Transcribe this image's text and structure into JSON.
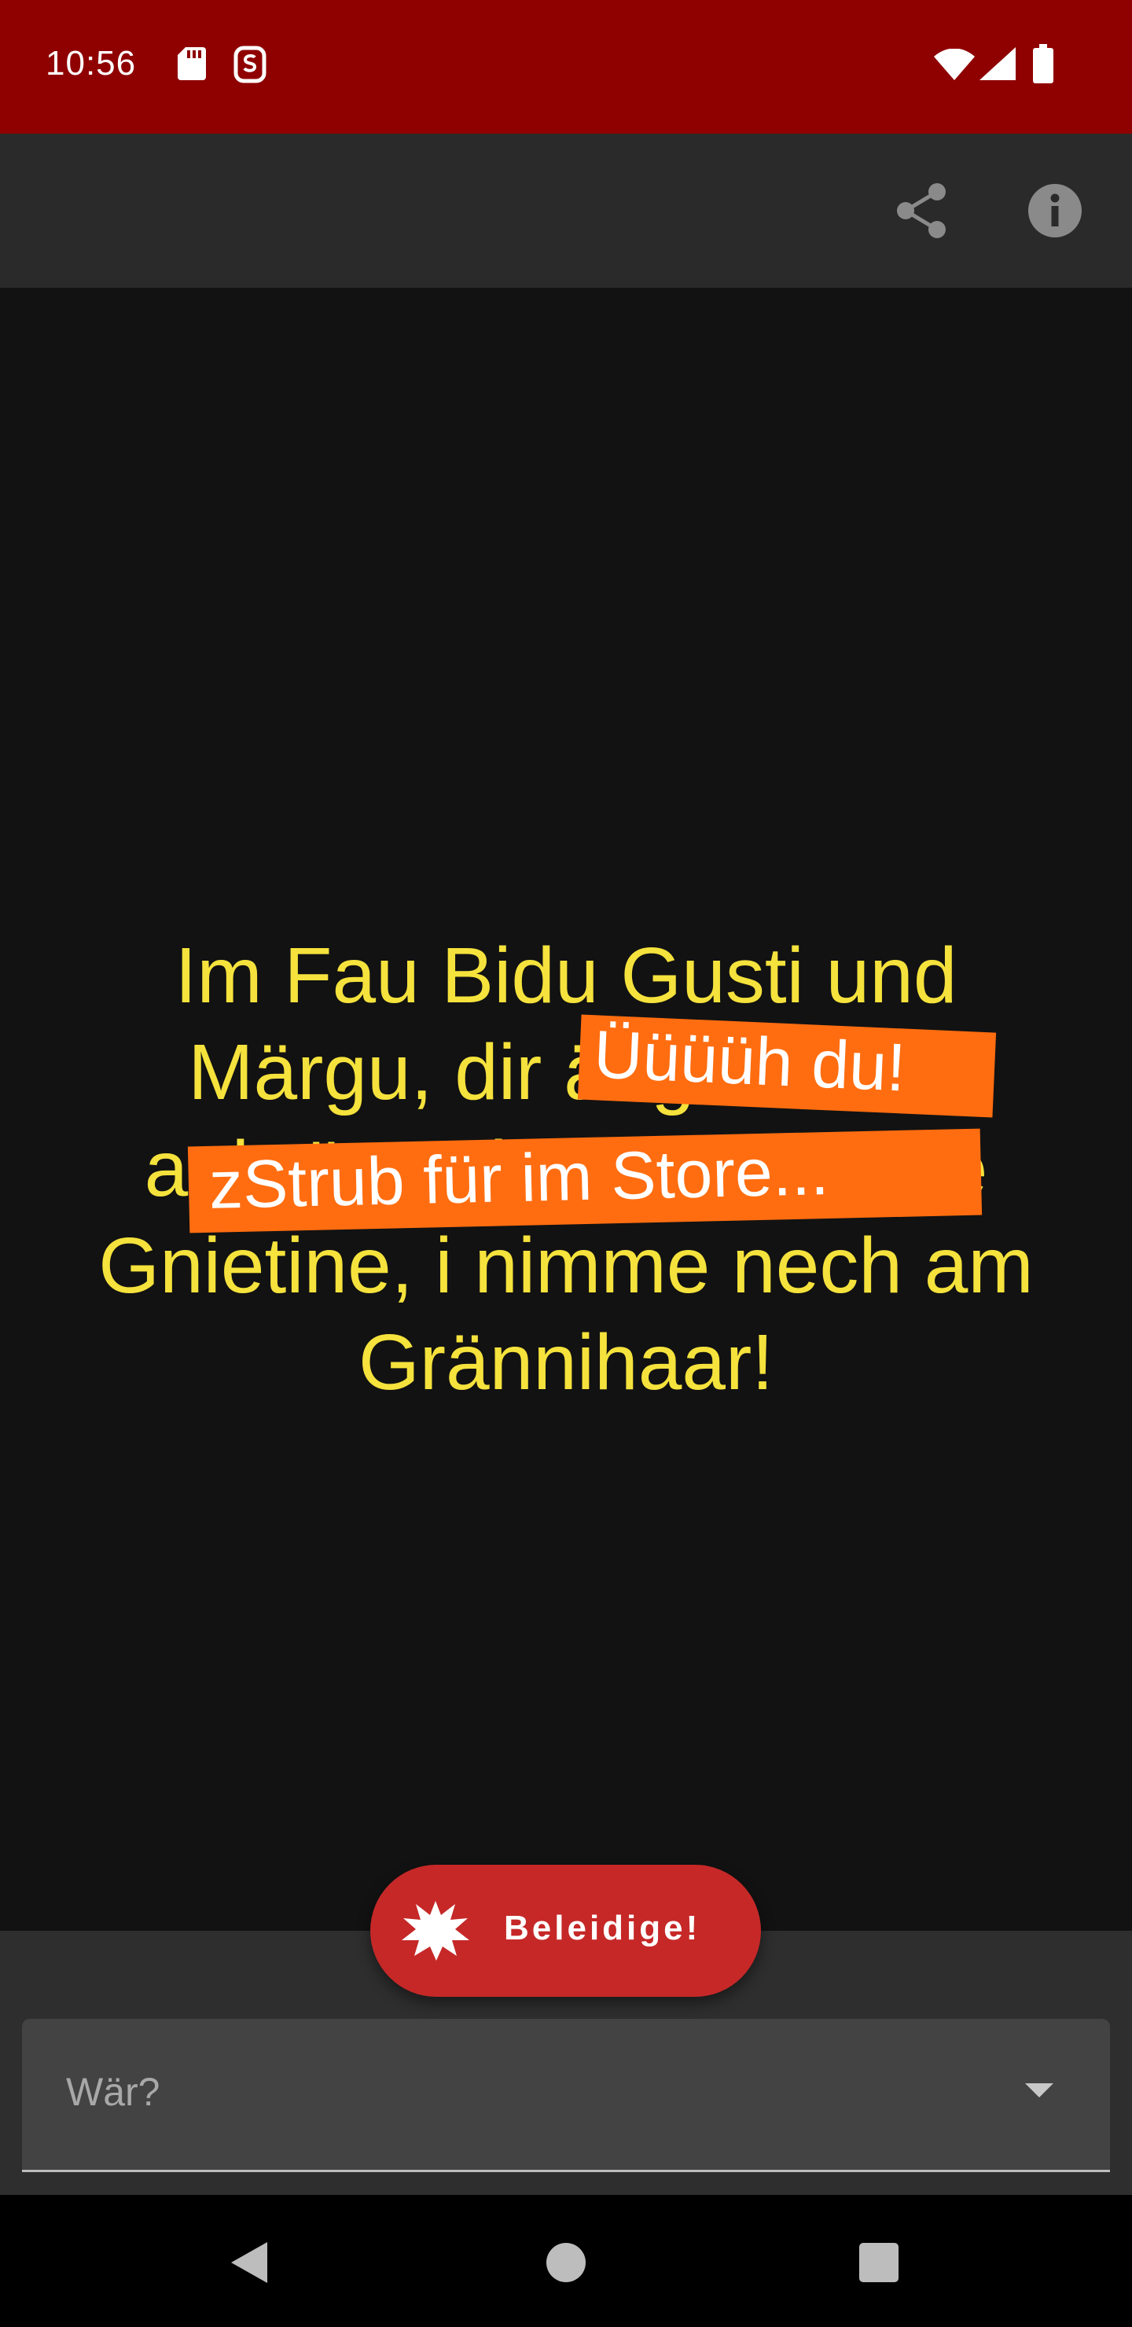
{
  "status_bar": {
    "time": "10:56",
    "icons": [
      "sd-card-icon",
      "s-notification-icon",
      "wifi-icon",
      "signal-icon",
      "battery-icon"
    ]
  },
  "app_bar": {
    "actions": [
      "share-icon",
      "info-icon"
    ]
  },
  "insult": {
    "lines": [
      "Im Fau Bidu Gusti und",
      "Märgu, dir ängstleche",
      "aabröntschen Gwüssige",
      "Gnietine, i nimme nech am",
      "Grännihaar!"
    ]
  },
  "stickers": {
    "top": "Üüüüh du!",
    "bottom": "zStrub für im Store..."
  },
  "fab": {
    "label": "Beleidige!",
    "icon": "explosion-icon"
  },
  "dropdown": {
    "label": "Wär?",
    "icon": "caret-down-icon"
  },
  "nav_bar": {
    "buttons": [
      "back-icon",
      "home-icon",
      "recents-icon"
    ]
  },
  "colors": {
    "status_bar": "#8f0000",
    "app_bar": "#2a2a2a",
    "background": "#121212",
    "insult_text": "#f5e23c",
    "sticker": "#ff6d10",
    "fab": "#c62828"
  }
}
